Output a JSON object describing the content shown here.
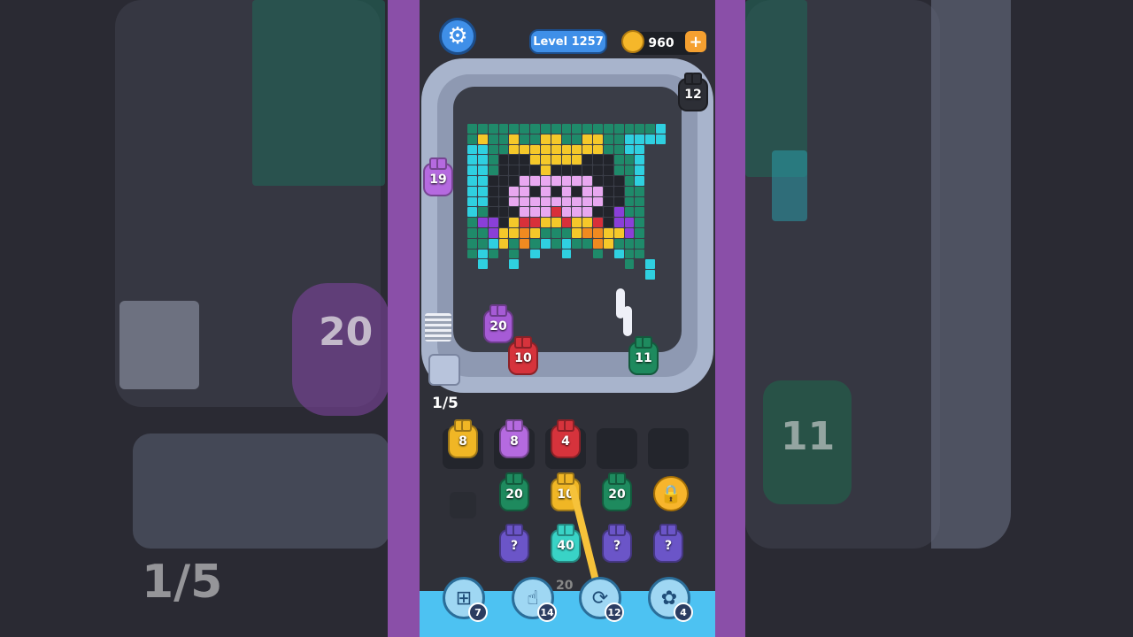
{
  "hud": {
    "level_label": "Level 1257",
    "coins": "960",
    "coin_plus": "+",
    "settings_icon": "gear-icon"
  },
  "track_pieces": [
    {
      "value": "12",
      "color": "#2d2f36"
    },
    {
      "value": "19",
      "color": "#b56ae0"
    },
    {
      "value": "20",
      "color": "#a65bd6"
    },
    {
      "value": "10",
      "color": "#d6333c"
    },
    {
      "value": "11",
      "color": "#1e8a5e"
    }
  ],
  "queue_progress": "1/5",
  "slots": [
    {
      "value": "8",
      "color": "#f0b625"
    },
    {
      "value": "8",
      "color": "#b56ae0"
    },
    {
      "value": "4",
      "color": "#d6333c"
    },
    {
      "value": "",
      "color": ""
    },
    {
      "value": "",
      "color": ""
    }
  ],
  "stacks": {
    "row1": [
      {
        "value": "20",
        "color": "#1e8a5e"
      },
      {
        "value": "10",
        "color": "#f0b625"
      },
      {
        "value": "20",
        "color": "#1e8a5e"
      }
    ],
    "row2": [
      {
        "value": "?",
        "color": "#6b55c8"
      },
      {
        "value": "40",
        "color": "#39d3c6"
      },
      {
        "value": "?",
        "color": "#6b55c8"
      },
      {
        "value": "?",
        "color": "#6b55c8"
      }
    ],
    "row3_hint": "20",
    "lock_icon": "padlock-icon"
  },
  "boosters": [
    {
      "icon": "add-slot-icon",
      "glyph": "⊞",
      "count": "7"
    },
    {
      "icon": "hand-pointer-icon",
      "glyph": "☝",
      "count": "14"
    },
    {
      "icon": "shuffle-icon",
      "glyph": "⟳",
      "count": "12"
    },
    {
      "icon": "bunny-icon",
      "glyph": "✿",
      "count": "4"
    }
  ],
  "background": {
    "left_piece_value": "20",
    "left_progress": "1/5",
    "right_piece_value": "11"
  }
}
